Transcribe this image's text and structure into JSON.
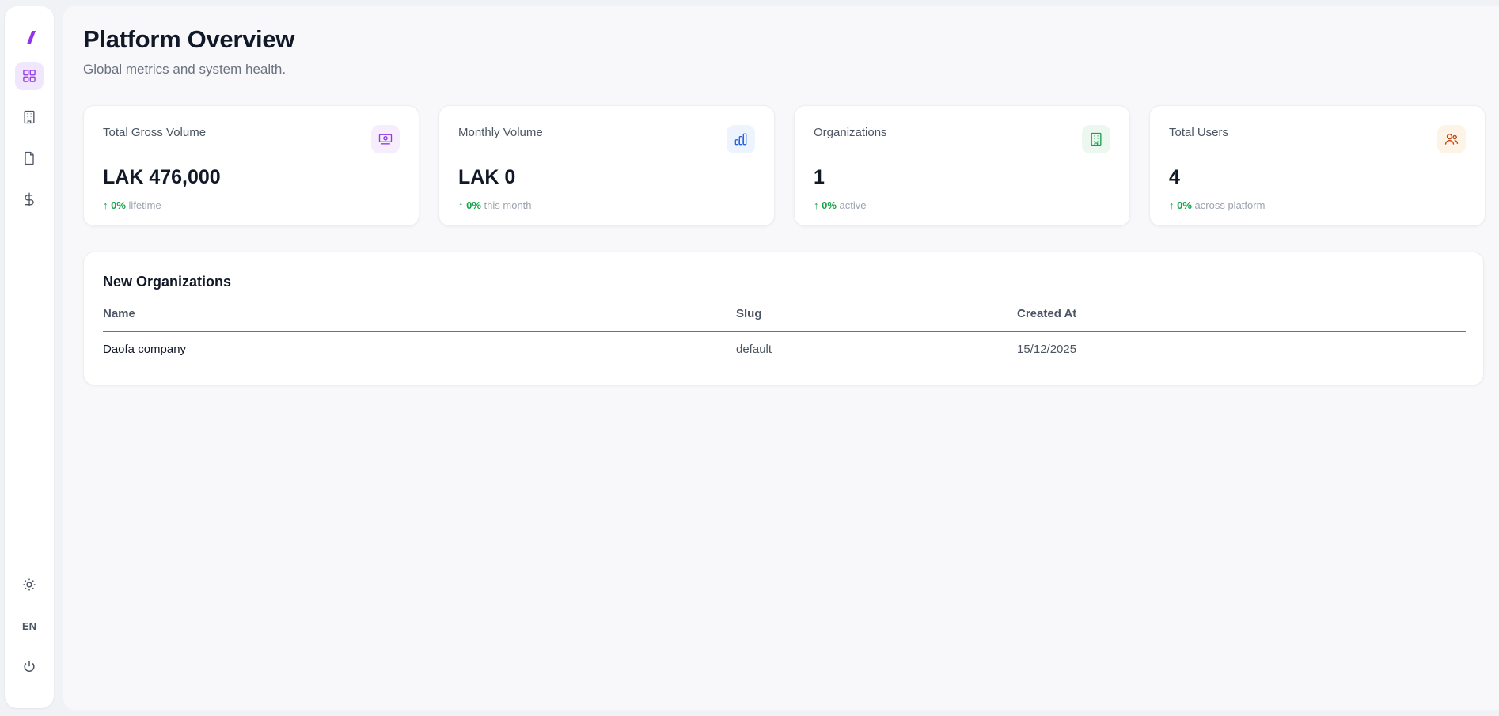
{
  "sidebar": {
    "logo_text": "//",
    "nav": [
      {
        "icon": "grid-icon",
        "active": true
      },
      {
        "icon": "building-icon",
        "active": false
      },
      {
        "icon": "file-icon",
        "active": false
      },
      {
        "icon": "dollar-icon",
        "active": false
      }
    ],
    "bottom": {
      "theme_icon": "sun-icon",
      "language": "EN",
      "power_icon": "power-icon"
    }
  },
  "header": {
    "title": "Platform Overview",
    "subtitle": "Global metrics and system health."
  },
  "cards": [
    {
      "label": "Total Gross Volume",
      "value": "LAK 476,000",
      "arrow": "↑",
      "delta": "0%",
      "note": "lifetime",
      "icon": "money-icon",
      "icon_color": "#9333ea",
      "icon_bg": "#f6eefc"
    },
    {
      "label": "Monthly Volume",
      "value": "LAK 0",
      "arrow": "↑",
      "delta": "0%",
      "note": "this month",
      "icon": "bar-chart-icon",
      "icon_color": "#2563eb",
      "icon_bg": "#eef4fd"
    },
    {
      "label": "Organizations",
      "value": "1",
      "arrow": "↑",
      "delta": "0%",
      "note": "active",
      "icon": "building-icon",
      "icon_color": "#16a34a",
      "icon_bg": "#ecf8ef"
    },
    {
      "label": "Total Users",
      "value": "4",
      "arrow": "↑",
      "delta": "0%",
      "note": "across platform",
      "icon": "users-icon",
      "icon_color": "#c2410c",
      "icon_bg": "#fdf3e7"
    }
  ],
  "table": {
    "title": "New Organizations",
    "columns": [
      "Name",
      "Slug",
      "Created At"
    ],
    "rows": [
      {
        "name": "Daofa company",
        "slug": "default",
        "created_at": "15/12/2025"
      }
    ]
  },
  "colors": {
    "accent": "#9333ea",
    "positive": "#16a34a"
  }
}
